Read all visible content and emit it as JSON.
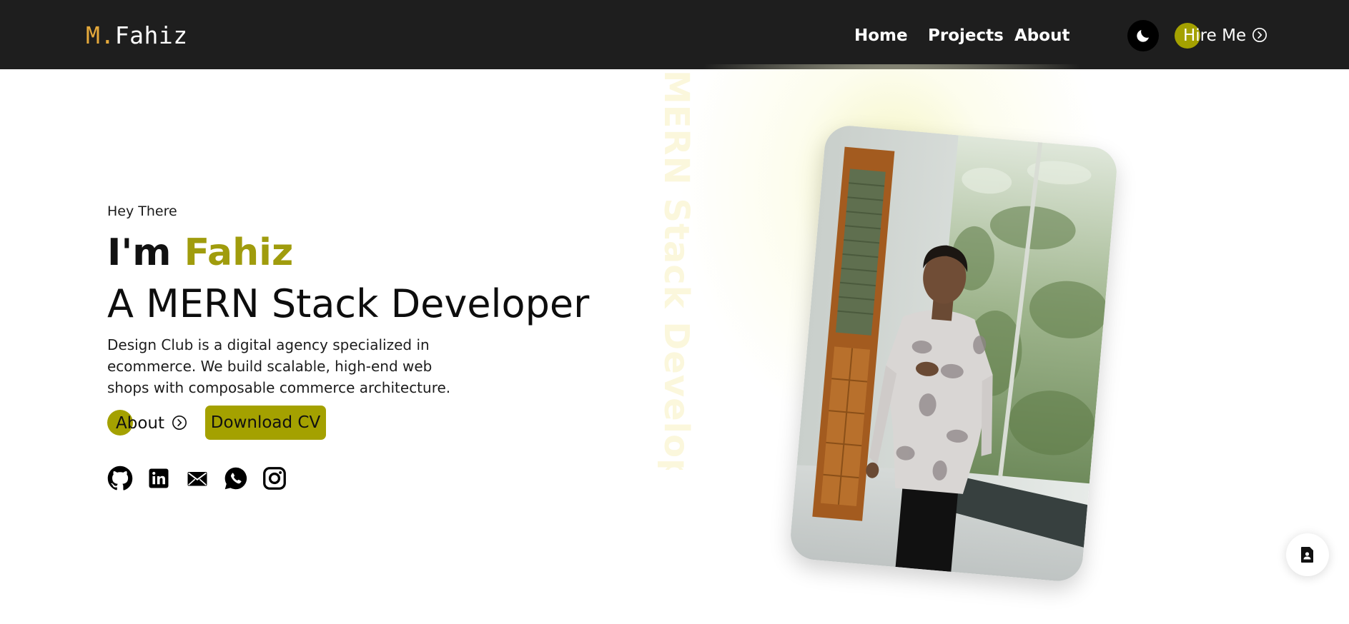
{
  "navbar": {
    "brand_prefix": "M.",
    "brand_name": "Fahiz",
    "links": [
      {
        "label": "Home"
      },
      {
        "label": "Projects"
      },
      {
        "label": "About"
      }
    ],
    "theme_toggle_icon": "moon-icon",
    "hire_me": {
      "label": "Hire Me",
      "icon": "chevron-right-circle-icon"
    }
  },
  "hero": {
    "greeting": "Hey There",
    "intro_prefix": "I'm ",
    "intro_name": "Fahiz",
    "role": "A MERN Stack Developer",
    "description": "Design Club is a digital agency specialized in ecommerce. We build scalable, high-end web shops with composable commerce architecture.",
    "about_button": {
      "label": "About",
      "icon": "chevron-right-circle-icon"
    },
    "cv_button": {
      "label": "Download CV"
    },
    "socials": [
      {
        "icon": "github-icon"
      },
      {
        "icon": "linkedin-icon"
      },
      {
        "icon": "mail-icon"
      },
      {
        "icon": "whatsapp-icon"
      },
      {
        "icon": "instagram-icon"
      }
    ],
    "watermark": "MERN Stack Developer"
  },
  "floating_action": {
    "icon": "resume-document-icon"
  },
  "colors": {
    "navbar_bg": "#1e1e1e",
    "accent": "#a4a100",
    "brand_prefix": "#e5a93b",
    "name_accent": "#a09c0d",
    "watermark": "#fbf7dc"
  }
}
